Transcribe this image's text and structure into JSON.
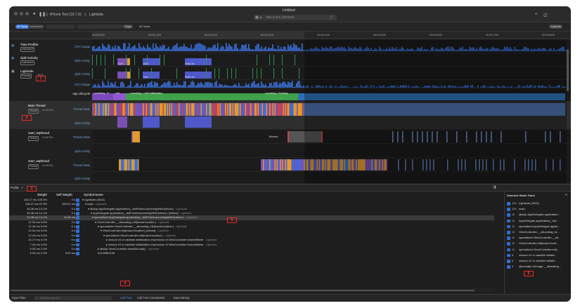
{
  "window": {
    "title": "Untitled"
  },
  "toolbar": {
    "device": "iPhone Test (16.7.6)",
    "separator": "❯",
    "app": "Lightside",
    "run_status": "Run 3 of 3 | 00:00:02"
  },
  "filterbar": {
    "pills": [
      "All Tracks",
      "Instruments",
      "Target",
      "All Tracks"
    ],
    "target_label": "Target",
    "all_tracks_label": "All Tracks",
    "duplicate_button": "Duplicate"
  },
  "ruler": {
    "ticks": [
      "00:00.000",
      "00:00.100",
      "00:00.200",
      "00:00.300",
      "00:00.400",
      "00:00.500",
      "00:00.600",
      "00:00.700",
      "00:00.800"
    ]
  },
  "tracks": {
    "rows": [
      {
        "name": "Time Profiler",
        "badge": "Instrument",
        "track": "CPU Usage"
      },
      {
        "name": "dyld Activity",
        "badge": "Instrument",
        "track": "dyld Activity"
      },
      {
        "name": "Lightside",
        "badge": "Process",
        "pid": "4513",
        "track": "dyld Activity"
      },
      {
        "name": "",
        "badge": "",
        "track": "CPU Usage"
      },
      {
        "name": "",
        "badge": "",
        "track": "App Lifecycle"
      },
      {
        "name": "Main Thread",
        "badge": "Thread",
        "tid": "0x19f783",
        "track": "Thread State"
      },
      {
        "name": "",
        "badge": "",
        "track": "dyld Activity"
      },
      {
        "name": "start_wqthread",
        "badge": "Thread",
        "tid": "0x19f78b",
        "track": "Thread State"
      },
      {
        "name": "",
        "badge": "",
        "track": "dyld Activity"
      },
      {
        "name": "start_wqthread",
        "badge": "Thread",
        "tid": "0x19f78c",
        "track": "Thread State"
      },
      {
        "name": "",
        "badge": "",
        "track": "dyld Activity"
      }
    ],
    "lifecycle_segments": [
      "Launching - P...",
      "Init",
      "Launching - UIKit Initialization",
      "Launching - Running"
    ],
    "blocked_label": "Blocked",
    "dyld_labels": [
      "Dyld...",
      "Dyld...",
      "Static Init...",
      "Dyld...",
      "Static Init..."
    ]
  },
  "annotations": [
    "1",
    "2",
    "3",
    "4",
    "5",
    "6"
  ],
  "profile": {
    "header_label": "Profile",
    "columns": {
      "weight": "Weight",
      "self_weight": "Self Weight",
      "symbol": "Symbol Name"
    },
    "rows": [
      {
        "weight": "243.27 ms 100.0%",
        "self": "0 s",
        "symbol": "▾ Lightside (4513)",
        "lib": ""
      },
      {
        "weight": "238.27 ms  97.9%",
        "self": "253.91 ms",
        "symbol": "▾ main",
        "lib": "Lightside"
      },
      {
        "weight": "34.38 ms  14.1%",
        "self": "0 s",
        "symbol": "▾ @objc AppDelegate.application(_:didFinishLaunchingWithOptions:)",
        "lib": "Lightside"
      },
      {
        "weight": "34.38 ms  14.1%",
        "self": "0 s",
        "symbol": "▾ AppDelegate.application(_:didFinishLaunchingWithOptions:) [inlined]",
        "lib": "Lightside"
      },
      {
        "weight": "34.38 ms  14.1%",
        "self": "11.84 ms",
        "symbol": "▾ specialized AppDelegate.application(_:didFinishLaunchingWithOptions:)",
        "lib": "Lightside"
      },
      {
        "weight": "12.34 ms   5.0%",
        "self": "0 s",
        "symbol": "▾ ViewController.__allocating_init(brand:localize:)",
        "lib": "Lightside"
      },
      {
        "weight": "12.34 ms   5.0%",
        "self": "0 s",
        "symbol": "▾ specialized ViewController.__allocating_init(brand:localize:)",
        "lib": "Lightside"
      },
      {
        "weight": "12.34 ms   5.0%",
        "self": "0 s",
        "symbol": "▾ ViewController.init(brand:localize:) [inlined]",
        "lib": "Lightside"
      },
      {
        "weight": "12.34 ms   5.0%",
        "self": "0 s",
        "symbol": "▾ specialized ViewController.init(brand:localize:)",
        "lib": "Lightside"
      },
      {
        "weight": "10.17 ms   4.1%",
        "self": "0 s",
        "symbol": "▸ closure #1 in variable initialization expression of ViewController.sharedWarer",
        "lib": "Lightside"
      },
      {
        "weight": "7.34 ms   3.0%",
        "self": "0 s",
        "symbol": "▸ closure #1 in variable initialization expression of ViewController.brandsWarer",
        "lib": "Lightside"
      },
      {
        "weight": "5.00 ms   2.0%",
        "self": "0 s",
        "symbol": "▸ @objc ViewController.viewDidLoad()",
        "lib": "Lightside"
      },
      {
        "weight": "5.00 ms   2.0%",
        "self": "5.00 ms",
        "symbol": "0x103861198",
        "lib": ""
      }
    ]
  },
  "heaviest": {
    "title": "Heaviest Stack Trace",
    "rows": [
      {
        "n": "119",
        "t": "Lightside (4513)"
      },
      {
        "n": "119",
        "t": "main"
      },
      {
        "n": "11",
        "t": "@objc AppDelegate.application..."
      },
      {
        "n": "11",
        "t": "AppDelegate.application(_:did..."
      },
      {
        "n": "11",
        "t": "specialized AppDelegate.applic..."
      },
      {
        "n": "11",
        "t": "ViewController.__allocating_ini..."
      },
      {
        "n": "11",
        "t": "specialized ViewController.__all..."
      },
      {
        "n": "11",
        "t": "ViewController.init(brand:local..."
      },
      {
        "n": "11",
        "t": "specialized ViewController.init(..."
      },
      {
        "n": "6",
        "t": "closure #1 in variable initializ..."
      },
      {
        "n": "6",
        "t": "closure #1 in variable initializ..."
      },
      {
        "n": "5",
        "t": "@nonobjc UIImage.__allocating..."
      }
    ]
  },
  "statusbar": {
    "input_filter": "Input Filter",
    "search_placeholder": "Involves Symbol",
    "call_tree": "Call Tree",
    "constraints": "Call Tree Constraints",
    "data_mining": "Data Mining"
  },
  "colors": {
    "window_bg": "#1e1e1e",
    "cpu_blue": "#3a6fd8",
    "thread_orange": "#e09a2c",
    "thread_red": "#d24040",
    "lifecycle_green": "#3fa14a",
    "lifecycle_purple": "#7b49b9",
    "annotation_red": "#e0302a"
  }
}
